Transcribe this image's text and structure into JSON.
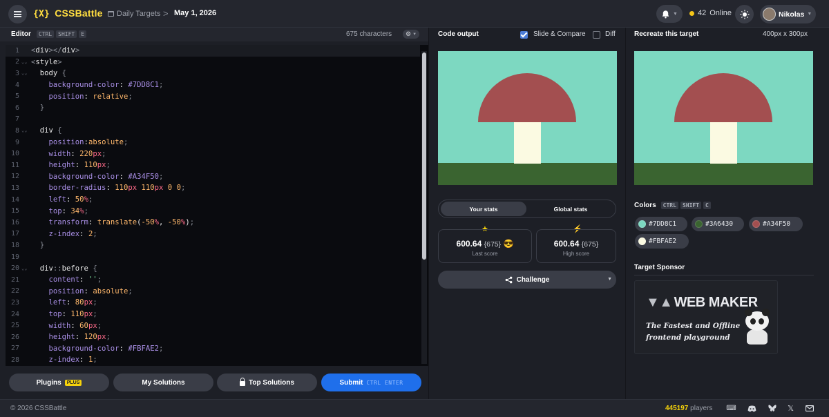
{
  "header": {
    "logo_mark": "{X}",
    "logo_text": "CSSBattle",
    "breadcrumb_section": "Daily Targets",
    "breadcrumb_separator": ">",
    "breadcrumb_current": "May 1, 2026",
    "online_count": "42",
    "online_label": "Online",
    "user_name": "Nikolas"
  },
  "editor": {
    "title": "Editor",
    "shortcut": [
      "CTRL",
      "SHIFT",
      "E"
    ],
    "char_count": "675 characters",
    "lines": [
      {
        "n": "1",
        "fold": "",
        "html": "<span class='t-punc'>&lt;</span><span class='t-tag'>div</span><span class='t-punc'>&gt;&lt;/</span><span class='t-tag'>div</span><span class='t-punc'>&gt;</span>",
        "text": "<div></div>"
      },
      {
        "n": "2",
        "fold": "⌄⌄",
        "text": "<style>"
      },
      {
        "n": "3",
        "fold": "⌄⌄",
        "text": "  body {"
      },
      {
        "n": "4",
        "fold": "",
        "text": "    background-color: #7DD8C1;"
      },
      {
        "n": "5",
        "fold": "",
        "text": "    position: relative;"
      },
      {
        "n": "6",
        "fold": "",
        "text": "  }"
      },
      {
        "n": "7",
        "fold": "",
        "text": ""
      },
      {
        "n": "8",
        "fold": "⌄⌄",
        "text": "  div {"
      },
      {
        "n": "9",
        "fold": "",
        "text": "    position:absolute;"
      },
      {
        "n": "10",
        "fold": "",
        "text": "    width: 220px;"
      },
      {
        "n": "11",
        "fold": "",
        "text": "    height: 110px;"
      },
      {
        "n": "12",
        "fold": "",
        "text": "    background-color: #A34F50;"
      },
      {
        "n": "13",
        "fold": "",
        "text": "    border-radius: 110px 110px 0 0;"
      },
      {
        "n": "14",
        "fold": "",
        "text": "    left: 50%;"
      },
      {
        "n": "15",
        "fold": "",
        "text": "    top: 34%;"
      },
      {
        "n": "16",
        "fold": "",
        "text": "    transform: translate(-50%, -50%);"
      },
      {
        "n": "17",
        "fold": "",
        "text": "    z-index: 2;"
      },
      {
        "n": "18",
        "fold": "",
        "text": "  }"
      },
      {
        "n": "19",
        "fold": "",
        "text": ""
      },
      {
        "n": "20",
        "fold": "⌄⌄",
        "text": "  div::before {"
      },
      {
        "n": "21",
        "fold": "",
        "text": "    content: '';"
      },
      {
        "n": "22",
        "fold": "",
        "text": "    position: absolute;"
      },
      {
        "n": "23",
        "fold": "",
        "text": "    left: 80px;"
      },
      {
        "n": "24",
        "fold": "",
        "text": "    top: 110px;"
      },
      {
        "n": "25",
        "fold": "",
        "text": "    width: 60px;"
      },
      {
        "n": "26",
        "fold": "",
        "text": "    height: 120px;"
      },
      {
        "n": "27",
        "fold": "",
        "text": "    background-color: #FBFAE2;"
      },
      {
        "n": "28",
        "fold": "",
        "text": "    z-index: 1;"
      }
    ]
  },
  "actions": {
    "plugins": "Plugins",
    "plus_badge": "PLUS",
    "my_solutions": "My Solutions",
    "top_solutions": "Top Solutions",
    "submit": "Submit",
    "submit_shortcut": "CTRL ENTER"
  },
  "output": {
    "title": "Code output",
    "slide_compare": "Slide & Compare",
    "slide_compare_checked": true,
    "diff": "Diff",
    "diff_checked": false
  },
  "stats": {
    "tab_your": "Your stats",
    "tab_global": "Global stats",
    "last_score": "600.64",
    "last_chars": "{675}",
    "last_emoji": "😎",
    "last_label": "Last score",
    "high_score": "600.64",
    "high_chars": "{675}",
    "high_label": "High score",
    "challenge": "Challenge"
  },
  "target": {
    "title": "Recreate this target",
    "size": "400px x 300px",
    "colors_title": "Colors",
    "colors_shortcut": [
      "CTRL",
      "SHIFT",
      "C"
    ],
    "colors": [
      "#7DD8C1",
      "#3A6430",
      "#A34F50",
      "#FBFAE2"
    ],
    "sponsor_title": "Target Sponsor",
    "sponsor_logo": "WEB MAKER",
    "sponsor_tagline": "The Fastest and Offline frontend playground"
  },
  "scene": {
    "sky": "#7DD8C1",
    "grass": "#3A6430",
    "cap": "#A34F50",
    "stem": "#FBFAE2"
  },
  "footer": {
    "copyright": "© 2026 CSSBattle",
    "players_count": "445197",
    "players_label": "players"
  },
  "icons": [
    "menu-icon",
    "calendar-icon",
    "bell-icon",
    "sun-icon",
    "gear-icon",
    "lock-icon",
    "star-icon",
    "bolt-icon",
    "share-icon",
    "discord-icon",
    "bluesky-icon",
    "x-icon",
    "mail-icon",
    "keyboard-icon"
  ]
}
